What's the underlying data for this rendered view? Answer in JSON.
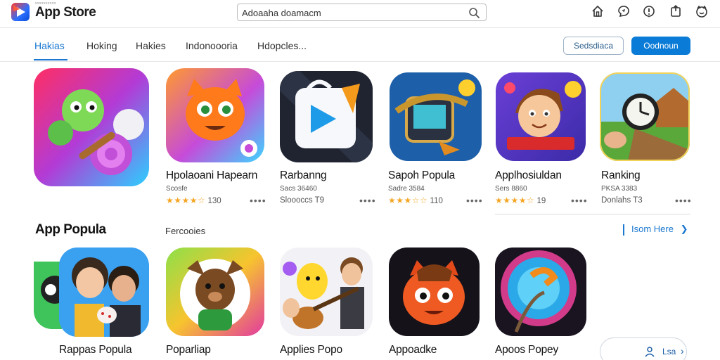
{
  "header": {
    "logo_subtitle": "xxxxxxxxxx",
    "title": "App Store",
    "search": {
      "value": "Adoaaha doamacm",
      "placeholder": ""
    },
    "icons": [
      "home-icon",
      "chat-icon",
      "info-icon",
      "share-icon",
      "smile-icon"
    ]
  },
  "nav": {
    "tabs": [
      {
        "label": "Hakias",
        "active": true
      },
      {
        "label": "Hoking",
        "active": false
      },
      {
        "label": "Hakies",
        "active": false
      },
      {
        "label": "Indonoooria",
        "active": false
      },
      {
        "label": "Hdopcles...",
        "active": false
      }
    ],
    "outline_button": "Sedsdiaca",
    "primary_button": "Oodnoun"
  },
  "top_apps": [
    {
      "name": "",
      "category": "",
      "rating_text": "",
      "icon": "dragon-candy-game-icon"
    },
    {
      "name": "Hpolaoani Hapearn",
      "category": "Scosfe",
      "stars": "★★★★☆",
      "rating_text": "130",
      "more": "••••",
      "icon": "orange-fox-icon"
    },
    {
      "name": "Rarbanng",
      "category": "Sacs 36460",
      "rating_text": "Sloooccs T9",
      "more": "••••",
      "icon": "play-video-icon"
    },
    {
      "name": "Sapoh Popula",
      "category": "Sadre 3584",
      "stars": "★★★☆☆",
      "rating_text": "110",
      "more": "••••",
      "icon": "robot-device-icon"
    },
    {
      "name": "Applhosiuldan",
      "category": "Sers 8860",
      "stars": "★★★★☆",
      "rating_text": "19",
      "more": "••••",
      "icon": "cartoon-boy-icon"
    },
    {
      "name": "Ranking",
      "category": "PKSA 3383",
      "rating_text": "Donlahs T3",
      "more": "••••",
      "icon": "clock-farm-icon"
    }
  ],
  "section": {
    "title": "App Popula",
    "subtitle": "Fercooies",
    "see_more": "Isom Here"
  },
  "bottom_apps": [
    {
      "name": "Rappas Popula",
      "icon": "family-selfie-icon"
    },
    {
      "name": "Poparliap",
      "icon": "brown-bear-icon"
    },
    {
      "name": "Applies Popo",
      "icon": "guitar-friends-icon"
    },
    {
      "name": "Appoadke",
      "icon": "red-monster-icon"
    },
    {
      "name": "Apoos Popey",
      "icon": "blue-portal-icon"
    }
  ],
  "bottom_pill": {
    "label": "Lsa"
  },
  "colors": {
    "accent": "#1b78d0",
    "primary_button": "#0a7bd6",
    "star": "#f4a623",
    "text": "#111111"
  }
}
